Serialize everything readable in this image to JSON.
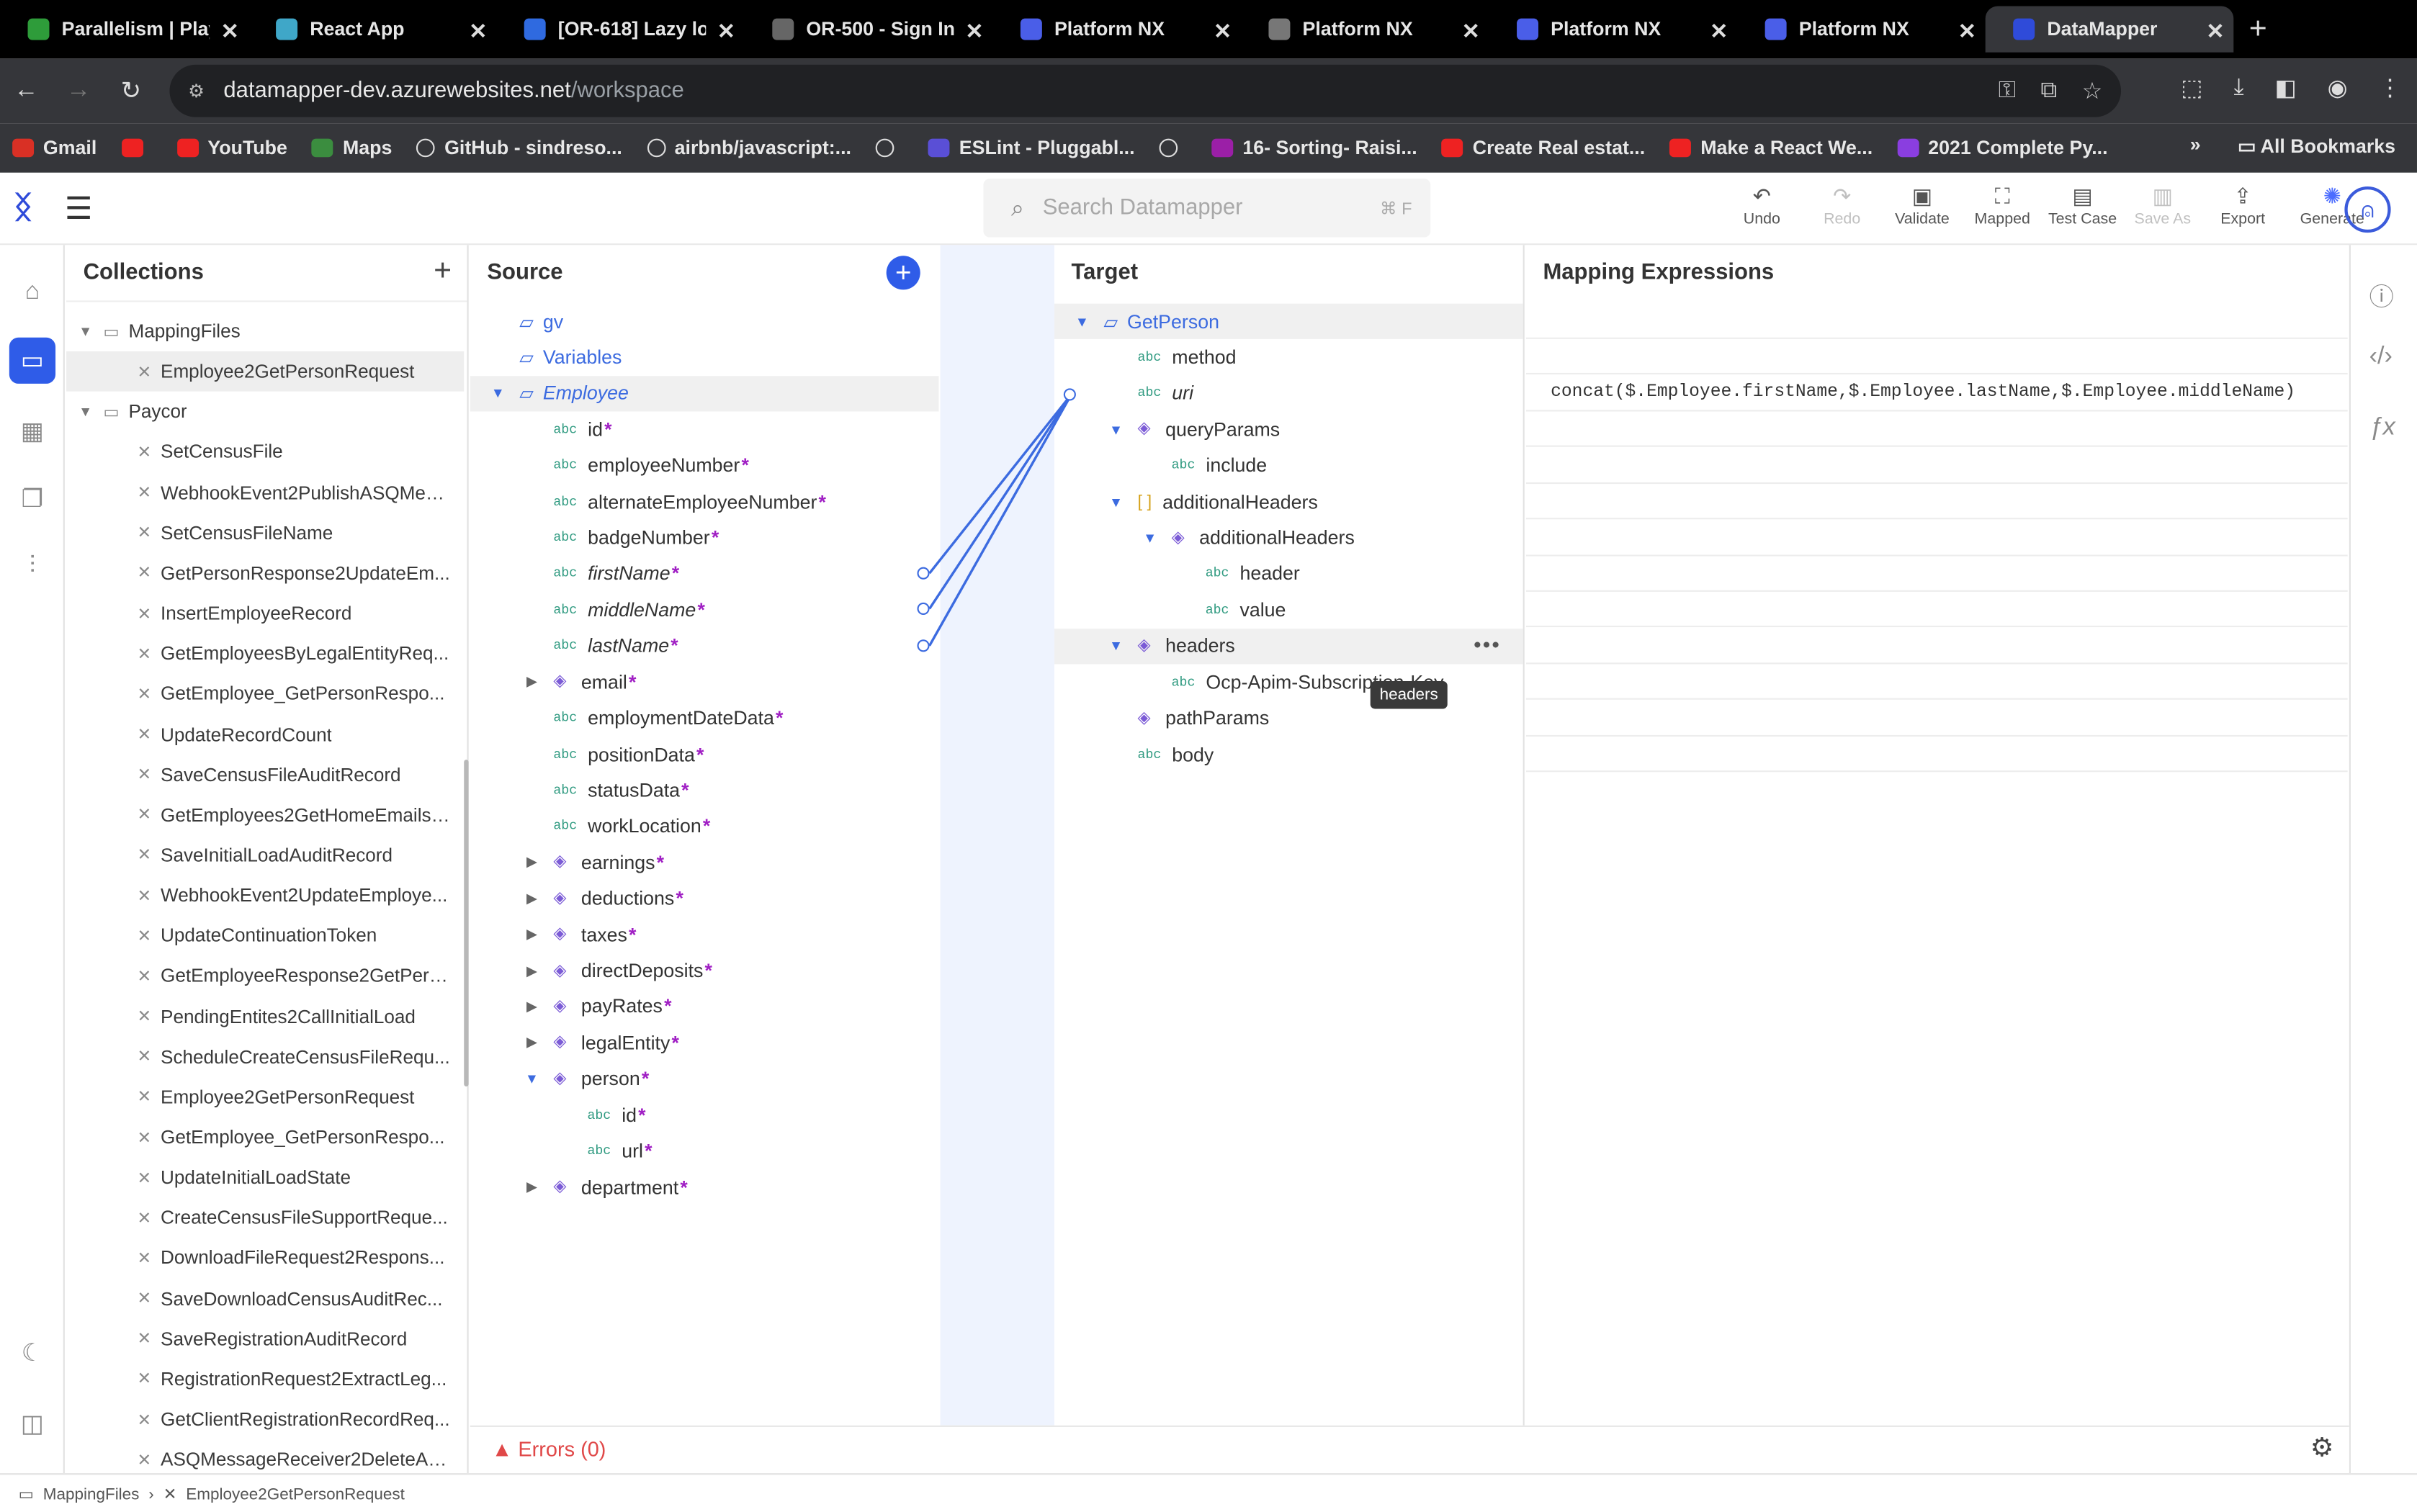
{
  "browser": {
    "tabs": [
      {
        "title": "Parallelism | Playw",
        "color": "#2e9c3a"
      },
      {
        "title": "React App",
        "color": "#3fa7c8"
      },
      {
        "title": "[OR-618] Lazy lo",
        "color": "#2f6ae0"
      },
      {
        "title": "OR-500 - Sign In",
        "color": "#666666"
      },
      {
        "title": "Platform NX",
        "color": "#4a5ee8"
      },
      {
        "title": "Platform NX",
        "color": "#777777"
      },
      {
        "title": "Platform NX",
        "color": "#4a5ee8"
      },
      {
        "title": "Platform NX",
        "color": "#4a5ee8"
      },
      {
        "title": "DataMapper",
        "color": "#2f4bd9"
      }
    ],
    "url_host": "datamapper-dev.azurewebsites.net",
    "url_path": "/workspace",
    "bookmarks": [
      "Gmail",
      "",
      "YouTube",
      "Maps",
      "GitHub - sindreso...",
      "airbnb/javascript:...",
      "",
      "ESLint - Pluggabl...",
      "",
      "16- Sorting- Raisi...",
      "Create Real estat...",
      "Make a React We...",
      "2021 Complete Py..."
    ],
    "all_bookmarks": "All Bookmarks"
  },
  "header": {
    "search_placeholder": "Search Datamapper",
    "search_shortcut": "⌘ F",
    "toolbar": [
      {
        "label": "Undo",
        "icon": "↶",
        "disabled": false
      },
      {
        "label": "Redo",
        "icon": "↷",
        "disabled": true
      },
      {
        "label": "Validate",
        "icon": "▣",
        "disabled": false
      },
      {
        "label": "Mapped",
        "icon": "⛶",
        "disabled": false
      },
      {
        "label": "Test Case",
        "icon": "▤",
        "disabled": false
      },
      {
        "label": "Save As",
        "icon": "▥",
        "disabled": true
      },
      {
        "label": "Export",
        "icon": "⇪",
        "disabled": false
      },
      {
        "label": "Generate",
        "icon": "✺",
        "disabled": false
      }
    ]
  },
  "collections": {
    "title": "Collections",
    "items": [
      {
        "label": "MappingFiles",
        "type": "folder",
        "level": 0
      },
      {
        "label": "Employee2GetPersonRequest",
        "type": "map",
        "level": 1,
        "selected": true
      },
      {
        "label": "Paycor",
        "type": "folder",
        "level": 0
      },
      {
        "label": "SetCensusFile",
        "type": "map",
        "level": 1
      },
      {
        "label": "WebhookEvent2PublishASQMess...",
        "type": "map",
        "level": 1
      },
      {
        "label": "SetCensusFileName",
        "type": "map",
        "level": 1
      },
      {
        "label": "GetPersonResponse2UpdateEm...",
        "type": "map",
        "level": 1
      },
      {
        "label": "InsertEmployeeRecord",
        "type": "map",
        "level": 1
      },
      {
        "label": "GetEmployeesByLegalEntityReq...",
        "type": "map",
        "level": 1
      },
      {
        "label": "GetEmployee_GetPersonRespo...",
        "type": "map",
        "level": 1
      },
      {
        "label": "UpdateRecordCount",
        "type": "map",
        "level": 1
      },
      {
        "label": "SaveCensusFileAuditRecord",
        "type": "map",
        "level": 1
      },
      {
        "label": "GetEmployees2GetHomeEmailsS...",
        "type": "map",
        "level": 1
      },
      {
        "label": "SaveInitialLoadAuditRecord",
        "type": "map",
        "level": 1
      },
      {
        "label": "WebhookEvent2UpdateEmploye...",
        "type": "map",
        "level": 1
      },
      {
        "label": "UpdateContinuationToken",
        "type": "map",
        "level": 1
      },
      {
        "label": "GetEmployeeResponse2GetPers...",
        "type": "map",
        "level": 1
      },
      {
        "label": "PendingEntites2CallInitialLoad",
        "type": "map",
        "level": 1
      },
      {
        "label": "ScheduleCreateCensusFileRequ...",
        "type": "map",
        "level": 1
      },
      {
        "label": "Employee2GetPersonRequest",
        "type": "map",
        "level": 1
      },
      {
        "label": "GetEmployee_GetPersonRespo...",
        "type": "map",
        "level": 1
      },
      {
        "label": "UpdateInitialLoadState",
        "type": "map",
        "level": 1
      },
      {
        "label": "CreateCensusFileSupportReque...",
        "type": "map",
        "level": 1
      },
      {
        "label": "DownloadFileRequest2Respons...",
        "type": "map",
        "level": 1
      },
      {
        "label": "SaveDownloadCensusAuditRec...",
        "type": "map",
        "level": 1
      },
      {
        "label": "SaveRegistrationAuditRecord",
        "type": "map",
        "level": 1
      },
      {
        "label": "RegistrationRequest2ExtractLeg...",
        "type": "map",
        "level": 1
      },
      {
        "label": "GetClientRegistrationRecordReq...",
        "type": "map",
        "level": 1
      },
      {
        "label": "ASQMessageReceiver2DeleteAS...",
        "type": "map",
        "level": 1
      }
    ]
  },
  "source": {
    "title": "Source",
    "rows": [
      {
        "label": "gv",
        "kind": "folder",
        "level": 0,
        "toggle": "",
        "blue": true
      },
      {
        "label": "Variables",
        "kind": "folder",
        "level": 0,
        "toggle": "",
        "blue": true
      },
      {
        "label": "Employee",
        "kind": "folder",
        "level": 0,
        "toggle": "open",
        "blue": true,
        "italic": true,
        "highlight": true
      },
      {
        "label": "id",
        "kind": "abc",
        "level": 1,
        "req": true
      },
      {
        "label": "employeeNumber",
        "kind": "abc",
        "level": 1,
        "req": true
      },
      {
        "label": "alternateEmployeeNumber",
        "kind": "abc",
        "level": 1,
        "req": true
      },
      {
        "label": "badgeNumber",
        "kind": "abc",
        "level": 1,
        "req": true
      },
      {
        "label": "firstName",
        "kind": "abc",
        "level": 1,
        "req": true,
        "italic": true,
        "mapped": true
      },
      {
        "label": "middleName",
        "kind": "abc",
        "level": 1,
        "req": true,
        "italic": true,
        "mapped": true
      },
      {
        "label": "lastName",
        "kind": "abc",
        "level": 1,
        "req": true,
        "italic": true,
        "mapped": true
      },
      {
        "label": "email",
        "kind": "obj",
        "level": 1,
        "req": true,
        "toggle": "closed"
      },
      {
        "label": "employmentDateData",
        "kind": "abc",
        "level": 1,
        "req": true
      },
      {
        "label": "positionData",
        "kind": "abc",
        "level": 1,
        "req": true
      },
      {
        "label": "statusData",
        "kind": "abc",
        "level": 1,
        "req": true
      },
      {
        "label": "workLocation",
        "kind": "abc",
        "level": 1,
        "req": true
      },
      {
        "label": "earnings",
        "kind": "obj",
        "level": 1,
        "req": true,
        "toggle": "closed"
      },
      {
        "label": "deductions",
        "kind": "obj",
        "level": 1,
        "req": true,
        "toggle": "closed"
      },
      {
        "label": "taxes",
        "kind": "obj",
        "level": 1,
        "req": true,
        "toggle": "closed"
      },
      {
        "label": "directDeposits",
        "kind": "obj",
        "level": 1,
        "req": true,
        "toggle": "closed"
      },
      {
        "label": "payRates",
        "kind": "obj",
        "level": 1,
        "req": true,
        "toggle": "closed"
      },
      {
        "label": "legalEntity",
        "kind": "obj",
        "level": 1,
        "req": true,
        "toggle": "closed"
      },
      {
        "label": "person",
        "kind": "obj",
        "level": 1,
        "req": true,
        "toggle": "open"
      },
      {
        "label": "id",
        "kind": "abc",
        "level": 2,
        "req": true
      },
      {
        "label": "url",
        "kind": "abc",
        "level": 2,
        "req": true
      },
      {
        "label": "department",
        "kind": "obj",
        "level": 1,
        "req": true,
        "toggle": "closed"
      }
    ]
  },
  "target": {
    "title": "Target",
    "rows": [
      {
        "label": "GetPerson",
        "kind": "folder",
        "level": 0,
        "toggle": "open",
        "blue": true,
        "highlight": true
      },
      {
        "label": "method",
        "kind": "abc",
        "level": 1
      },
      {
        "label": "uri",
        "kind": "abc",
        "level": 1,
        "italic": true,
        "mapped": true
      },
      {
        "label": "queryParams",
        "kind": "obj",
        "level": 1,
        "toggle": "open"
      },
      {
        "label": "include",
        "kind": "abc",
        "level": 2
      },
      {
        "label": "additionalHeaders",
        "kind": "arr",
        "level": 1,
        "toggle": "open"
      },
      {
        "label": "additionalHeaders",
        "kind": "obj",
        "level": 2,
        "toggle": "open"
      },
      {
        "label": "header",
        "kind": "abc",
        "level": 3
      },
      {
        "label": "value",
        "kind": "abc",
        "level": 3
      },
      {
        "label": "headers",
        "kind": "obj",
        "level": 1,
        "toggle": "open",
        "highlight": true
      },
      {
        "label": "Ocp-Apim-Subscription-Key",
        "kind": "abc",
        "level": 2
      },
      {
        "label": "pathParams",
        "kind": "obj",
        "level": 1
      },
      {
        "label": "body",
        "kind": "abc",
        "level": 1
      }
    ],
    "tooltip": "headers"
  },
  "mapping": {
    "title": "Mapping Expressions",
    "expressions": [
      "",
      "",
      "concat($.Employee.firstName,$.Employee.lastName,$.Employee.middleName)",
      "",
      "",
      "",
      "",
      "",
      "",
      "",
      "",
      "",
      ""
    ]
  },
  "footer": {
    "errors": "Errors (0)",
    "breadcrumb": [
      "MappingFiles",
      "Employee2GetPersonRequest"
    ]
  }
}
